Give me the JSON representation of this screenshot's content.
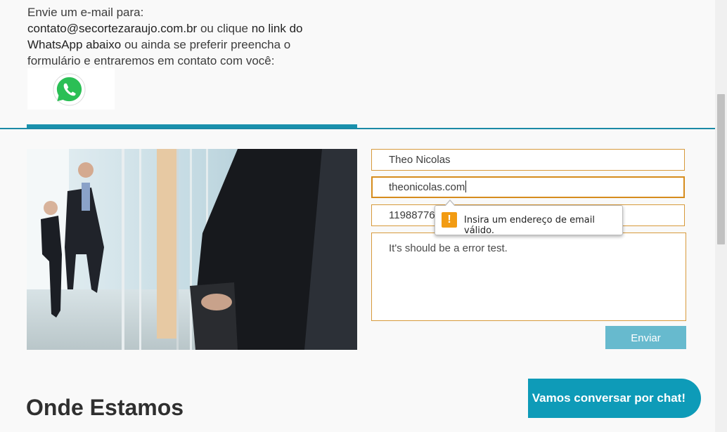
{
  "intro": {
    "line1": "Envie um e-mail para:",
    "email": "contato@secortezaraujo.com.br",
    "or_click": " ou clique ",
    "link_text": "no link do WhatsApp abaixo",
    "rest": " ou ainda se preferir preencha o formulário e entraremos em contato com você:"
  },
  "whatsapp": {
    "icon": "whatsapp-icon",
    "color": "#25d366"
  },
  "form": {
    "name_value": "Theo Nicolas",
    "email_value": "theonicolas.com",
    "phone_value": "11988776",
    "message_value": "It's should be a error test.",
    "send_label": "Enviar"
  },
  "tooltip": {
    "icon": "warning-icon",
    "message": "Insira um endereço de email válido."
  },
  "section_title": "Onde Estamos",
  "chat_button": "Vamos conversar por chat!",
  "colors": {
    "accent": "#1a91ad",
    "field_border": "#d79a3b",
    "send_button": "#67bace",
    "chat_button": "#0e9bb8",
    "warning": "#f29b12"
  }
}
